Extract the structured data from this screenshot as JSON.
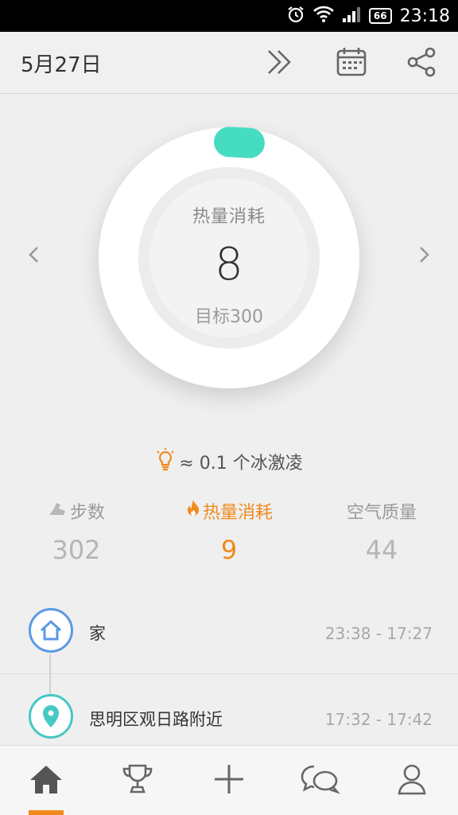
{
  "status_bar": {
    "time": "23:18",
    "battery": "66"
  },
  "header": {
    "date": "5月27日",
    "icons": [
      "fast-forward-icon",
      "calendar-icon",
      "share-icon"
    ]
  },
  "ring": {
    "title": "热量消耗",
    "value": "8",
    "goal_label": "目标300"
  },
  "tip": {
    "icon": "lightbulb-icon",
    "text": "≈ 0.1 个冰激凌"
  },
  "stats": [
    {
      "label": "步数",
      "value": "302",
      "icon": "shoe-icon"
    },
    {
      "label": "热量消耗",
      "value": "9",
      "icon": "flame-icon"
    },
    {
      "label": "空气质量",
      "value": "44"
    }
  ],
  "places": [
    {
      "name": "家",
      "time_range": "23:38 - 17:27",
      "icon": "home-icon"
    },
    {
      "name": "思明区观日路附近",
      "time_range": "17:32 - 17:42",
      "icon": "location-pin-icon"
    }
  ],
  "tabs": [
    "home-icon",
    "trophy-icon",
    "plus-icon",
    "chat-icon",
    "profile-icon"
  ],
  "colors": {
    "accent": "#f08a1c",
    "teal": "#46dcc1",
    "blue": "#5a9ae6"
  }
}
